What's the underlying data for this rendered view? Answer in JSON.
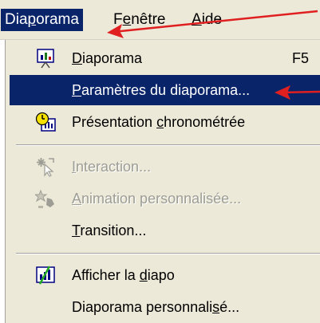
{
  "menubar": {
    "items": [
      {
        "pre": "Dia",
        "u": "p",
        "post": "orama"
      },
      {
        "pre": "F",
        "u": "e",
        "post": "nêtre"
      },
      {
        "pre": "",
        "u": "A",
        "post": "ide"
      }
    ]
  },
  "menu": {
    "items": [
      {
        "pre": "",
        "u": "D",
        "post": "iaporama",
        "shortcut": "F5"
      },
      {
        "pre": "",
        "u": "P",
        "post": "aramètres du diaporama..."
      },
      {
        "pre": "Présentation ",
        "u": "c",
        "post": "hronométrée"
      },
      {
        "pre": "",
        "u": "I",
        "post": "nteraction..."
      },
      {
        "pre": "",
        "u": "A",
        "post": "nimation personnalisée..."
      },
      {
        "pre": "",
        "u": "T",
        "post": "ransition..."
      },
      {
        "pre": "Afficher la ",
        "u": "d",
        "post": "iapo"
      },
      {
        "pre": "Diaporama personnali",
        "u": "s",
        "post": "é..."
      }
    ]
  },
  "colors": {
    "menu_bg": "#ece9d8",
    "highlight": "#0a246a",
    "arrow": "#e02020",
    "disabled_text": "#9d9d95"
  }
}
